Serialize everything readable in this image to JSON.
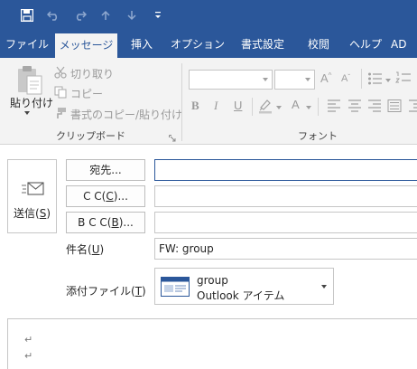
{
  "tabs": [
    {
      "label": "ファイル"
    },
    {
      "label": "メッセージ"
    },
    {
      "label": "挿入"
    },
    {
      "label": "オプション"
    },
    {
      "label": "書式設定"
    },
    {
      "label": "校閲"
    },
    {
      "label": "ヘルプ"
    },
    {
      "label": "AD"
    }
  ],
  "active_tab": "メッセージ",
  "clipboard": {
    "paste_label": "貼り付け",
    "cut_label": "切り取り",
    "copy_label": "コピー",
    "format_painter_label": "書式のコピー/貼り付け",
    "group_label": "クリップボード"
  },
  "font_group": {
    "group_label": "フォント",
    "font_name": "",
    "font_size": ""
  },
  "compose": {
    "send_label": "送信(",
    "send_key": "S",
    "send_close": ")",
    "to_label": "宛先...",
    "cc_label_a": "C C(",
    "cc_key": "C",
    "cc_label_b": ")...",
    "bcc_label_a": "B C C(",
    "bcc_key": "B",
    "bcc_label_b": ")...",
    "to_value": "",
    "cc_value": "",
    "bcc_value": "",
    "subject_label_a": "件名(",
    "subject_key": "U",
    "subject_label_b": ")",
    "subject_value": "FW: group",
    "attach_label_a": "添付ファイル(",
    "attach_key": "T",
    "attach_label_b": ")",
    "attachment": {
      "name": "group",
      "type": "Outlook アイテム"
    },
    "paragraph_marks": [
      "↵",
      "↵"
    ]
  },
  "colors": {
    "accent": "#2b579a",
    "ribbon_bg": "#f3f3f3",
    "disabled_text": "#9a9a9a"
  }
}
